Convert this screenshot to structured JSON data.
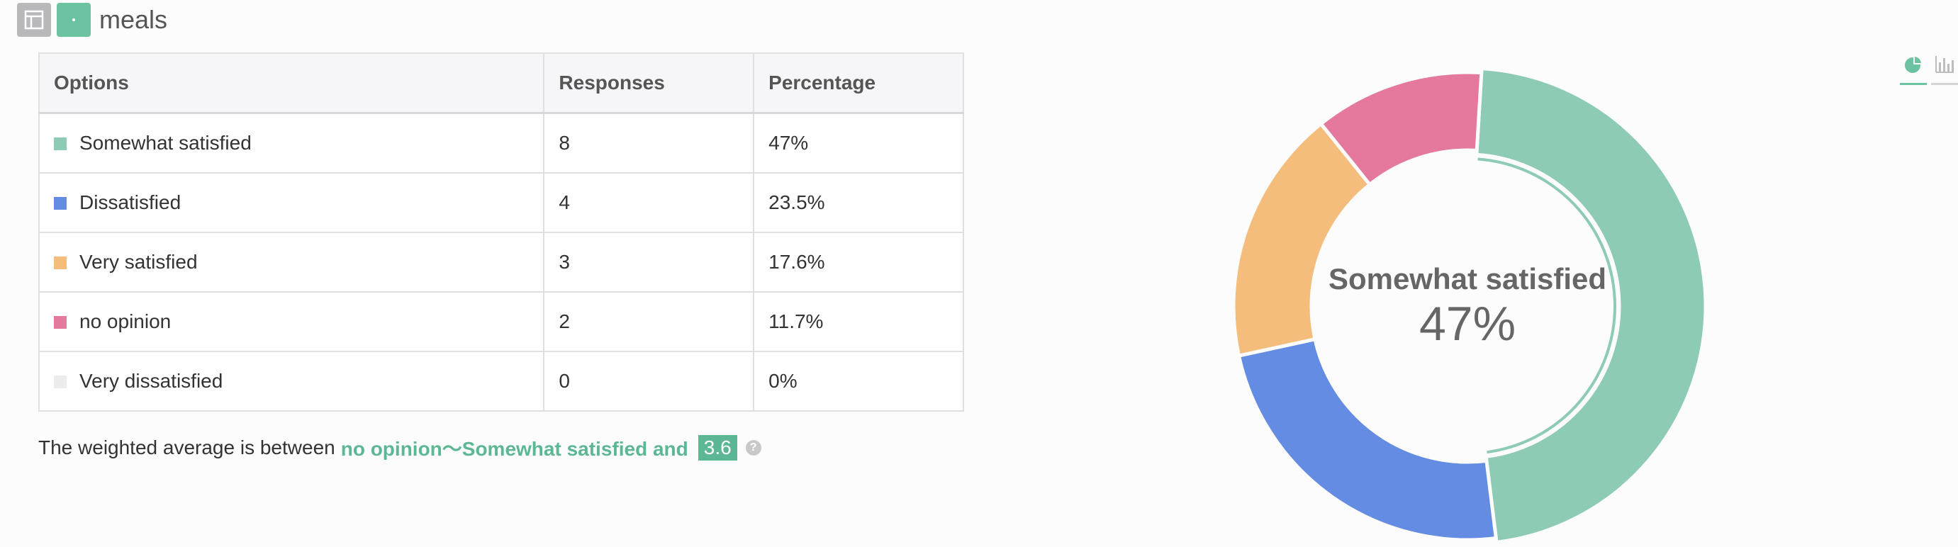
{
  "header": {
    "title": "meals",
    "layout_icon": "panel-layout-icon",
    "question_icon": "single-choice-icon"
  },
  "table": {
    "headers": [
      "Options",
      "Responses",
      "Percentage"
    ],
    "rows": [
      {
        "option": "Somewhat satisfied",
        "responses": "8",
        "percentage": "47%",
        "color": "#8ecbb4"
      },
      {
        "option": "Dissatisfied",
        "responses": "4",
        "percentage": "23.5%",
        "color": "#648ce2"
      },
      {
        "option": "Very satisfied",
        "responses": "3",
        "percentage": "17.6%",
        "color": "#f4bd7b"
      },
      {
        "option": "no opinion",
        "responses": "2",
        "percentage": "11.7%",
        "color": "#e4799d"
      },
      {
        "option": "Very dissatisfied",
        "responses": "0",
        "percentage": "0%",
        "color": "#ececec"
      }
    ]
  },
  "summary": {
    "prefix": "The weighted average is between",
    "range": "no opinion～Somewhat satisfied and",
    "value": "3.6"
  },
  "chart_tabs": [
    {
      "name": "pie-chart-icon",
      "active": true
    },
    {
      "name": "bar-chart-icon",
      "active": false
    }
  ],
  "chart_data": {
    "type": "pie",
    "categories": [
      "Somewhat satisfied",
      "Dissatisfied",
      "Very satisfied",
      "no opinion",
      "Very dissatisfied"
    ],
    "values": [
      47,
      23.5,
      17.6,
      11.7,
      0
    ],
    "colors": [
      "#8ecbb4",
      "#648ce2",
      "#f4bd7b",
      "#e4799d",
      "#ececec"
    ],
    "center_label": "Somewhat satisfied",
    "center_value": "47%"
  }
}
